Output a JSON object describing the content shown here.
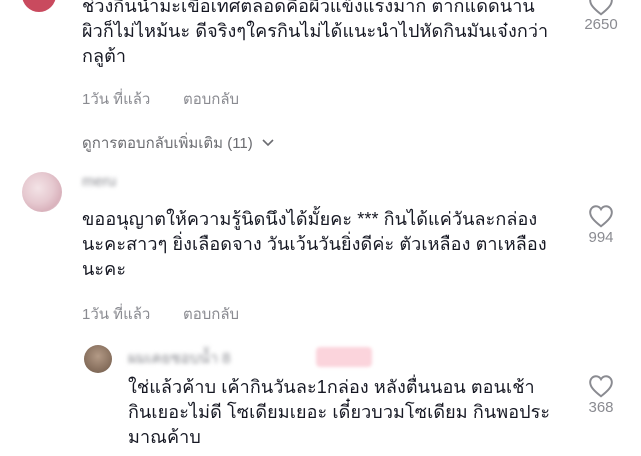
{
  "comment_top": {
    "lines": [
      "ช่วงกินน้ำมะเขือเทศตลอดคือผิวแข็งแรงมาก ตากแดดนาน",
      "ผิวก็ไม่ไหม้นะ ดีจริงๆใครกินไม่ได้แนะนำไปหัดกินมันเจ๋งกว่า",
      "กลูต้า"
    ],
    "time": "1วัน ที่แล้ว",
    "reply_label": "ตอบกลับ",
    "likes": "2650",
    "view_more_replies": "ดูการตอบกลับเพิ่มเติม (11)"
  },
  "comment_1": {
    "username": "meru",
    "lines": [
      "ขออนุญาตให้ความรู้นิดนึงได้มั้ยคะ *** กินได้แค่วันละกล่อง",
      "นะคะสาวๆ ยิ่งเลือดจาง วันเว้นวันยิ่งดีค่ะ ตัวเหลือง ตาเหลือง",
      "นะคะ"
    ],
    "time": "1วัน ที่แล้ว",
    "reply_label": "ตอบกลับ",
    "likes": "994"
  },
  "reply_1": {
    "username": "ผมเคยชอบน้ำ 8",
    "lines": [
      "ใช่แล้วค้าบ เค้ากินวันละ1กล่อง หลังตื่นนอน ตอนเช้า",
      "กินเยอะไม่ดี โซเดียมเยอะ เดี๋ยวบวมโซเดียม กินพอประ",
      "มาณค้าบ"
    ],
    "likes": "368"
  },
  "colors": {
    "text": "#161823",
    "muted": "#8a8b91",
    "heart_stroke": "#8a8b91"
  }
}
